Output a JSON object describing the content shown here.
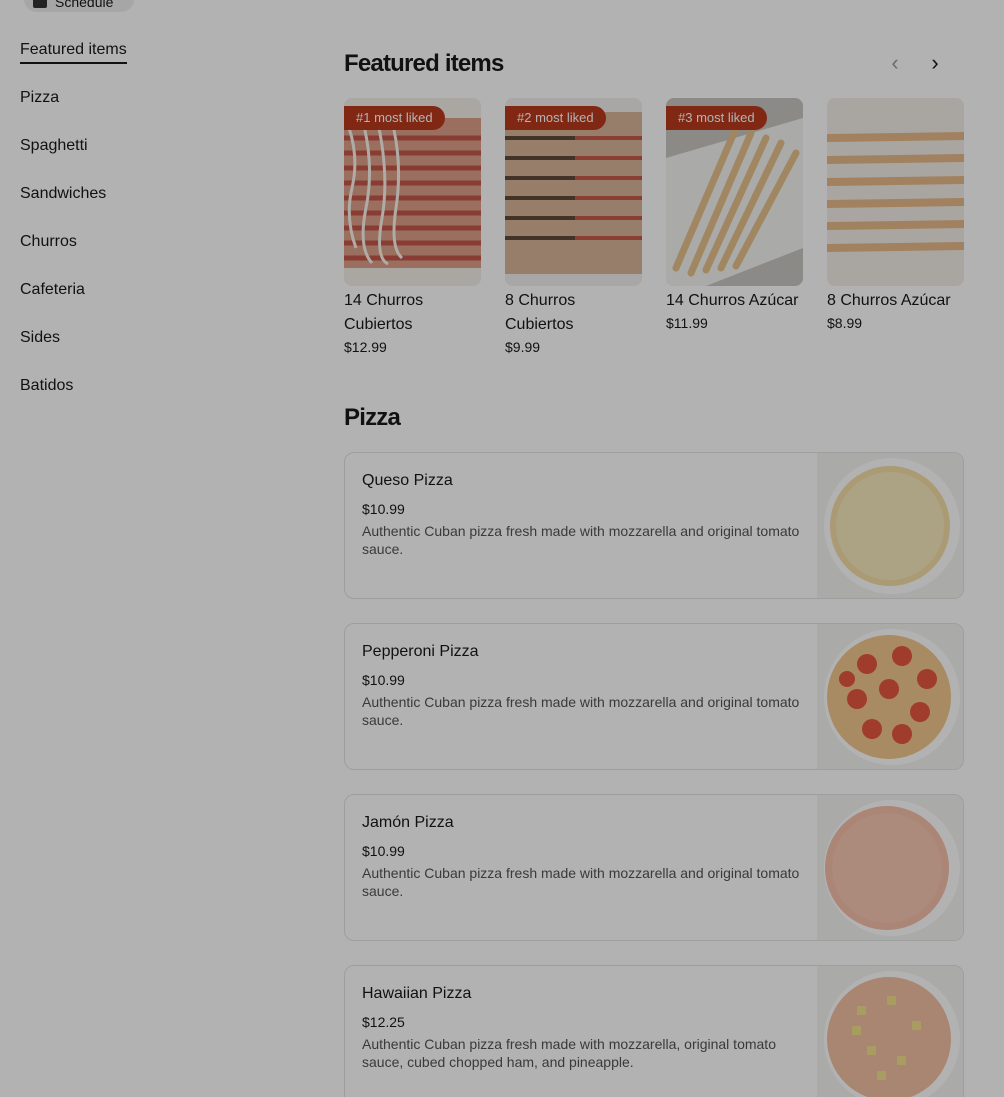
{
  "schedule_button": {
    "label": "Schedule"
  },
  "sidebar": {
    "items": [
      {
        "label": "Featured items",
        "active": true
      },
      {
        "label": "Pizza"
      },
      {
        "label": "Spaghetti"
      },
      {
        "label": "Sandwiches"
      },
      {
        "label": "Churros"
      },
      {
        "label": "Cafeteria"
      },
      {
        "label": "Sides"
      },
      {
        "label": "Batidos"
      }
    ]
  },
  "featured": {
    "title": "Featured items",
    "prev_icon": "chevron-left-icon",
    "next_icon": "chevron-right-icon",
    "items": [
      {
        "badge": "#1 most liked",
        "name": "14 Churros Cubiertos",
        "price": "$12.99"
      },
      {
        "badge": "#2 most liked",
        "name": "8 Churros Cubiertos",
        "price": "$9.99"
      },
      {
        "badge": "#3 most liked",
        "name": "14 Churros Azúcar",
        "price": "$11.99"
      },
      {
        "badge": "",
        "name": "8 Churros Azúcar",
        "price": "$8.99"
      }
    ]
  },
  "pizza": {
    "title": "Pizza",
    "items": [
      {
        "name": "Queso Pizza",
        "price": "$10.99",
        "description": "Authentic Cuban pizza fresh made with mozzarella and original tomato sauce."
      },
      {
        "name": "Pepperoni Pizza",
        "price": "$10.99",
        "description": "Authentic Cuban pizza fresh made with mozzarella and original tomato sauce."
      },
      {
        "name": "Jamón Pizza",
        "price": "$10.99",
        "description": "Authentic Cuban pizza fresh made with mozzarella and original tomato sauce."
      },
      {
        "name": "Hawaiian Pizza",
        "price": "$12.25",
        "description": "Authentic Cuban pizza fresh made with mozzarella, original tomato sauce, cubed chopped ham, and pineapple."
      }
    ]
  },
  "colors": {
    "badge": "#b83a1e",
    "text": "#191919",
    "overlay": "rgba(0,0,0,0.30)"
  }
}
